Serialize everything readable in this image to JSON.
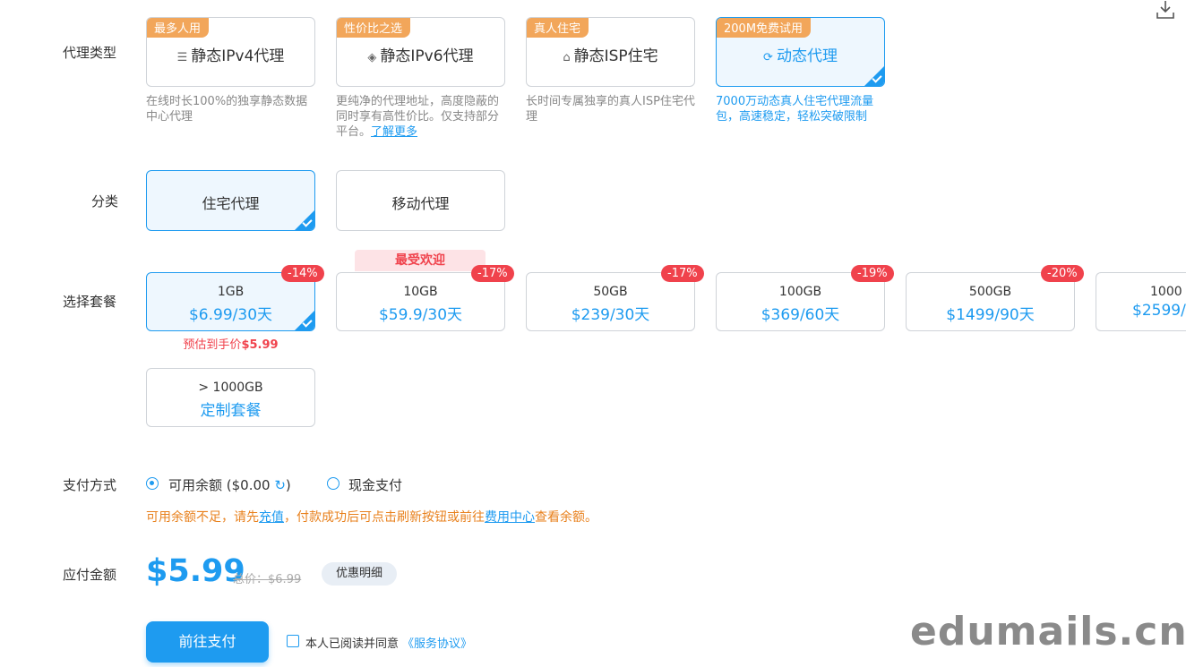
{
  "labels": {
    "proxy_type": "代理类型",
    "category": "分类",
    "plan": "选择套餐",
    "payment": "支付方式",
    "amount": "应付金额"
  },
  "proxy_types": [
    {
      "tag": "最多人用",
      "icon": "server-icon",
      "title": "静态IPv4代理",
      "desc": "在线时长100%的独享静态数据中心代理",
      "selected": false
    },
    {
      "tag": "性价比之选",
      "icon": "layers-icon",
      "title": "静态IPv6代理",
      "desc": "更纯净的代理地址，高度隐蔽的同时享有高性价比。仅支持部分平台。",
      "link": "了解更多",
      "selected": false
    },
    {
      "tag": "真人住宅",
      "icon": "home-icon",
      "title": "静态ISP住宅",
      "desc": "长时间专属独享的真人ISP住宅代理",
      "selected": false
    },
    {
      "tag": "200M免费试用",
      "icon": "refresh-icon",
      "title": "动态代理",
      "desc": "7000万动态真人住宅代理流量包，高速稳定，轻松突破限制",
      "selected": true
    }
  ],
  "categories": [
    {
      "label": "住宅代理",
      "selected": true
    },
    {
      "label": "移动代理",
      "selected": false
    }
  ],
  "popular_label": "最受欢迎",
  "plans": [
    {
      "size": "1GB",
      "price": "$6.99/30天",
      "discount": "-14%",
      "selected": true
    },
    {
      "size": "10GB",
      "price": "$59.9/30天",
      "discount": "-17%",
      "selected": false
    },
    {
      "size": "50GB",
      "price": "$239/30天",
      "discount": "-17%",
      "selected": false
    },
    {
      "size": "100GB",
      "price": "$369/60天",
      "discount": "-19%",
      "selected": false
    },
    {
      "size": "500GB",
      "price": "$1499/90天",
      "discount": "-20%",
      "selected": false
    },
    {
      "size": "1000",
      "price": "$2599/",
      "discount": "",
      "selected": false
    }
  ],
  "estimated": {
    "prefix": "预估到手价",
    "value": "$5.99"
  },
  "custom_plan": {
    "size": "> 1000GB",
    "label": "定制套餐"
  },
  "payment": {
    "balance_label": "可用余额 ($0.00",
    "balance_suffix": ")",
    "cash_label": "现金支付",
    "notice_1": "可用余额不足，请先",
    "notice_link_1": "充值",
    "notice_2": "，付款成功后可点击刷新按钮或前往",
    "notice_link_2": "费用中心",
    "notice_3": "查看余额。"
  },
  "amount": {
    "price": "$5.99",
    "total_label": "总价：",
    "total_value": "$6.99",
    "detail_button": "优惠明细"
  },
  "pay_button": "前往支付",
  "agreement": {
    "text": "本人已阅读并同意",
    "link": "《服务协议》"
  },
  "watermark": "edumails.cn",
  "colors": {
    "accent": "#1e9bf0",
    "tag_orange": "#f2a65a",
    "discount_red": "#f0424c",
    "notice_orange": "#e8801c"
  }
}
